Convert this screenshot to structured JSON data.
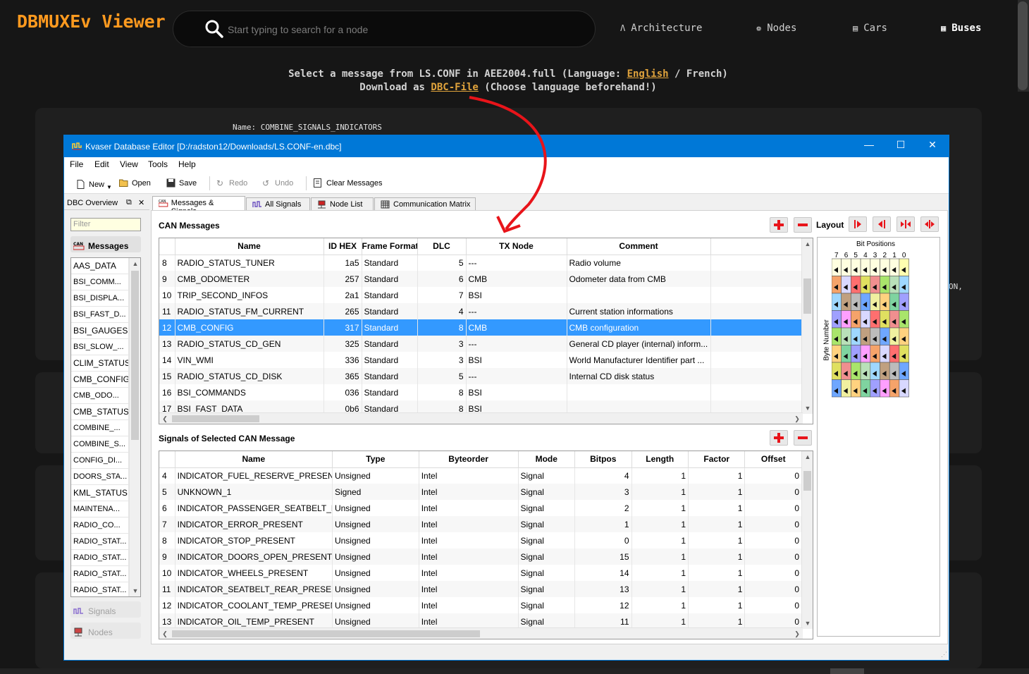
{
  "app": {
    "logo": "DBMUXEv Viewer",
    "search_placeholder": "Start typing to search for a node",
    "nav": [
      {
        "label": "Architecture",
        "icon": "architecture-icon"
      },
      {
        "label": "Nodes",
        "icon": "nodes-icon"
      },
      {
        "label": "Cars",
        "icon": "car-icon"
      },
      {
        "label": "Buses",
        "icon": "bus-icon",
        "active": true
      }
    ],
    "info_line1_pre": "Select a message from LS.CONF in AEE2004.full (Language: ",
    "info_lang_en": "English",
    "info_line1_post": " / French)",
    "info_line2_pre": "Download as ",
    "info_dbc_link": "DBC-File",
    "info_line2_post": " (Choose language beforehand!)",
    "name_line": "Name: COMBINE_SIGNALS_INDICATORS",
    "truncated_text": "ON,"
  },
  "window": {
    "title": "Kvaser Database Editor [D:/radston12/Downloads/LS.CONF-en.dbc]",
    "menu": [
      "File",
      "Edit",
      "View",
      "Tools",
      "Help"
    ],
    "toolbar": {
      "new": "New",
      "open": "Open",
      "save": "Save",
      "redo": "Redo",
      "undo": "Undo",
      "clear": "Clear Messages"
    },
    "dock": {
      "title": "DBC Overview",
      "filter_placeholder": "Filter",
      "messages_btn": "Messages",
      "signals_btn": "Signals",
      "nodes_btn": "Nodes",
      "messages": [
        "AAS_DATA",
        "BSI_COMM...",
        "BSI_DISPLA...",
        "BSI_FAST_D...",
        "BSI_GAUGES",
        "BSI_SLOW_...",
        "CLIM_STATUS",
        "CMB_CONFIG",
        "CMB_ODO...",
        "CMB_STATUS",
        "COMBINE_...",
        "COMBINE_S...",
        "CONFIG_DI...",
        "DOORS_STA...",
        "KML_STATUS",
        "MAINTENA...",
        "RADIO_CO...",
        "RADIO_STAT...",
        "RADIO_STAT...",
        "RADIO_STAT...",
        "RADIO_STAT..."
      ]
    },
    "tabs": [
      "Messages & Signals",
      "All Signals",
      "Node List",
      "Communication Matrix"
    ],
    "can_messages": {
      "title": "CAN Messages",
      "columns": [
        "Name",
        "ID HEX",
        "Frame Format",
        "DLC",
        "TX Node",
        "Comment"
      ],
      "rows": [
        [
          "8",
          "RADIO_STATUS_TUNER",
          "1a5",
          "Standard",
          "5",
          "---",
          "Radio volume"
        ],
        [
          "9",
          "CMB_ODOMETER",
          "257",
          "Standard",
          "6",
          "CMB",
          "Odometer data from CMB"
        ],
        [
          "10",
          "TRIP_SECOND_INFOS",
          "2a1",
          "Standard",
          "7",
          "BSI",
          ""
        ],
        [
          "11",
          "RADIO_STATUS_FM_CURRENT",
          "265",
          "Standard",
          "4",
          "---",
          "Current station informations"
        ],
        [
          "12",
          "CMB_CONFIG",
          "317",
          "Standard",
          "8",
          "CMB",
          "CMB configuration"
        ],
        [
          "13",
          "RADIO_STATUS_CD_GEN",
          "325",
          "Standard",
          "3",
          "---",
          "General CD player (internal) inform..."
        ],
        [
          "14",
          "VIN_WMI",
          "336",
          "Standard",
          "3",
          "BSI",
          "World Manufacturer Identifier part ..."
        ],
        [
          "15",
          "RADIO_STATUS_CD_DISK",
          "365",
          "Standard",
          "5",
          "---",
          "Internal CD disk status"
        ],
        [
          "16",
          "BSI_COMMANDS",
          "036",
          "Standard",
          "8",
          "BSI",
          ""
        ],
        [
          "17",
          "BSI_FAST_DATA",
          "0b6",
          "Standard",
          "8",
          "BSI",
          ""
        ]
      ],
      "selected_row": 4
    },
    "signals": {
      "title": "Signals of Selected CAN Message",
      "columns": [
        "Name",
        "Type",
        "Byteorder",
        "Mode",
        "Bitpos",
        "Length",
        "Factor",
        "Offset"
      ],
      "rows": [
        [
          "4",
          "INDICATOR_FUEL_RESERVE_PRESENT",
          "Unsigned",
          "Intel",
          "Signal",
          "4",
          "1",
          "1",
          "0"
        ],
        [
          "5",
          "UNKNOWN_1",
          "Signed",
          "Intel",
          "Signal",
          "3",
          "1",
          "1",
          "0"
        ],
        [
          "6",
          "INDICATOR_PASSENGER_SEATBELT_PRE...",
          "Unsigned",
          "Intel",
          "Signal",
          "2",
          "1",
          "1",
          "0"
        ],
        [
          "7",
          "INDICATOR_ERROR_PRESENT",
          "Unsigned",
          "Intel",
          "Signal",
          "1",
          "1",
          "1",
          "0"
        ],
        [
          "8",
          "INDICATOR_STOP_PRESENT",
          "Unsigned",
          "Intel",
          "Signal",
          "0",
          "1",
          "1",
          "0"
        ],
        [
          "9",
          "INDICATOR_DOORS_OPEN_PRESENT",
          "Unsigned",
          "Intel",
          "Signal",
          "15",
          "1",
          "1",
          "0"
        ],
        [
          "10",
          "INDICATOR_WHEELS_PRESENT",
          "Unsigned",
          "Intel",
          "Signal",
          "14",
          "1",
          "1",
          "0"
        ],
        [
          "11",
          "INDICATOR_SEATBELT_REAR_PRESENT",
          "Unsigned",
          "Intel",
          "Signal",
          "13",
          "1",
          "1",
          "0"
        ],
        [
          "12",
          "INDICATOR_COOLANT_TEMP_PRESENT",
          "Unsigned",
          "Intel",
          "Signal",
          "12",
          "1",
          "1",
          "0"
        ],
        [
          "13",
          "INDICATOR_OIL_TEMP_PRESENT",
          "Unsigned",
          "Intel",
          "Signal",
          "11",
          "1",
          "1",
          "0"
        ]
      ]
    },
    "layout": {
      "label": "Layout",
      "bit_title": "Bit Positions",
      "byte_label": "Byte Number",
      "bit_headers": [
        "7",
        "6",
        "5",
        "4",
        "3",
        "2",
        "1",
        "0"
      ],
      "byte_numbers": [
        "0",
        "1",
        "2",
        "3",
        "4",
        "5",
        "6",
        "7"
      ],
      "colors": [
        "#bcbcbc",
        "#f08f8f",
        "#ff9fff",
        "#6fa7ff",
        "#a9e56b",
        "#f5a36a",
        "#f0f0a0",
        "#b9e0b9",
        "#d8d8ff",
        "#ffd27f",
        "#9fd7ff",
        "#ff6f6f",
        "#7fd4a0",
        "#c0a080",
        "#e0e060",
        "#a0a0ff"
      ]
    },
    "colors": {
      "titlebar": "#0078d7",
      "selection": "#3399ff",
      "accent": "#ff9a1f",
      "link": "#e0a33c",
      "annotation_arrow": "#e8141a"
    }
  }
}
